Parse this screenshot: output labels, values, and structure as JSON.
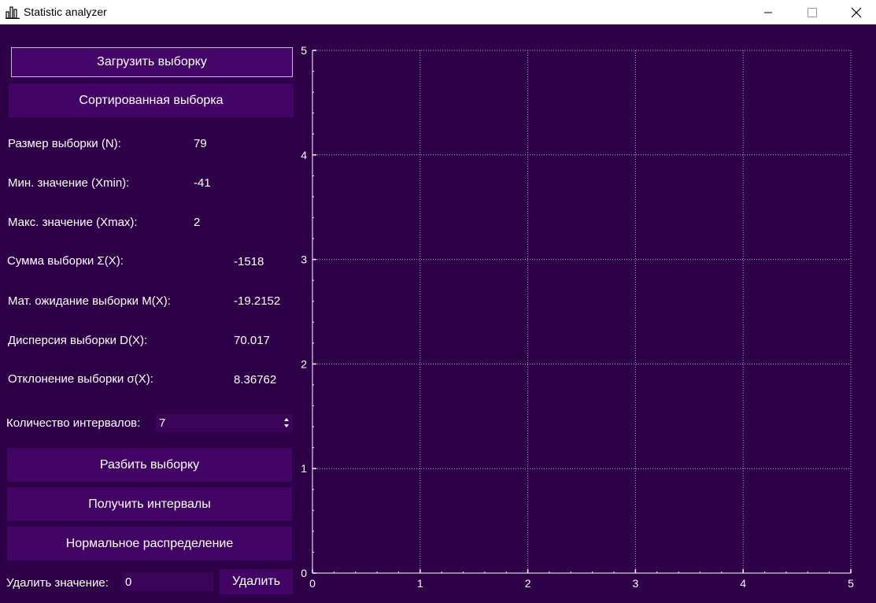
{
  "window": {
    "title": "Statistic analyzer",
    "icon": "bar-chart-icon"
  },
  "buttons": {
    "load": "Загрузить выборку",
    "sorted": "Сортированная выборка",
    "split": "Разбить выборку",
    "intervals": "Получить интервалы",
    "normal": "Нормальное распределение",
    "delete": "Удалить"
  },
  "stats": [
    {
      "label": "Размер выборки (N):",
      "value": "79"
    },
    {
      "label": "Мин. значение (Xmin):",
      "value": "-41"
    },
    {
      "label": "Макс. значение (Xmax):",
      "value": "2"
    },
    {
      "label": "Сумма выборки Σ(X):",
      "value": "-1518"
    },
    {
      "label": "Мат. ожидание выборки M(X):",
      "value": "-19.2152"
    },
    {
      "label": "Дисперсия выборки D(X):",
      "value": "70.017"
    },
    {
      "label": "Отклонение выборки σ(X):",
      "value": "8.36762"
    }
  ],
  "intervals": {
    "label": "Количество интервалов:",
    "value": "7"
  },
  "remove": {
    "label": "Удалить значение:",
    "value": "0"
  },
  "colors": {
    "background": "#2d0047",
    "button": "#430565",
    "text": "#ffffff",
    "grid": "#bfa9cf"
  },
  "chart_data": {
    "type": "line",
    "series": [],
    "xlim": [
      0,
      5
    ],
    "ylim": [
      0,
      5
    ],
    "x_ticks": [
      "0",
      "1",
      "2",
      "3",
      "4",
      "5"
    ],
    "y_ticks": [
      "0",
      "1",
      "2",
      "3",
      "4",
      "5"
    ],
    "grid": true,
    "title": "",
    "xlabel": "",
    "ylabel": ""
  }
}
